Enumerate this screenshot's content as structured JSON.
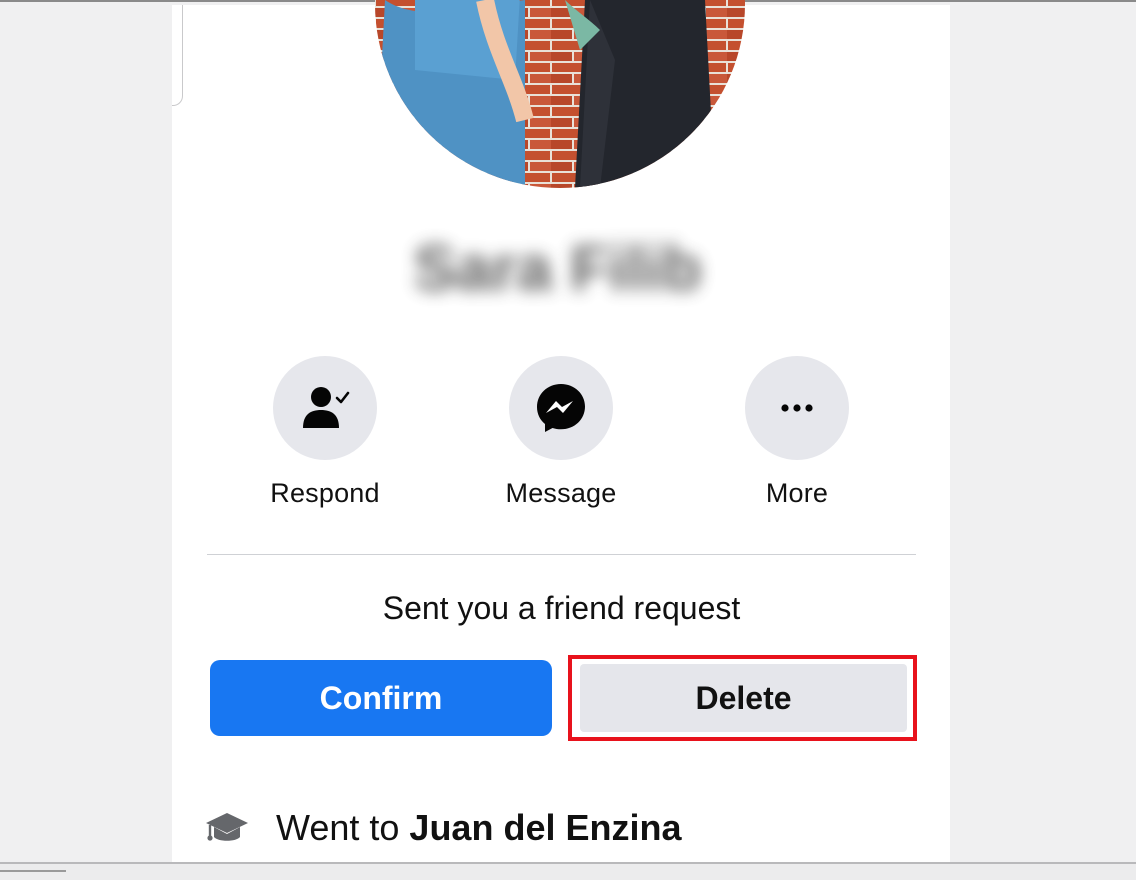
{
  "profile": {
    "name": "Sara Filib"
  },
  "actions": [
    {
      "label": "Respond",
      "icon": "person-check-icon"
    },
    {
      "label": "Message",
      "icon": "messenger-icon"
    },
    {
      "label": "More",
      "icon": "more-dots-icon"
    }
  ],
  "request": {
    "text": "Sent you a friend request",
    "confirm_label": "Confirm",
    "delete_label": "Delete"
  },
  "education": {
    "prefix": "Went to",
    "school": "Juan del Enzina",
    "icon": "graduation-cap-icon"
  },
  "colors": {
    "confirm": "#1877f2",
    "delete_bg": "#e5e6eb",
    "highlight": "#e8121c",
    "action_circle": "#e6e7ec"
  }
}
